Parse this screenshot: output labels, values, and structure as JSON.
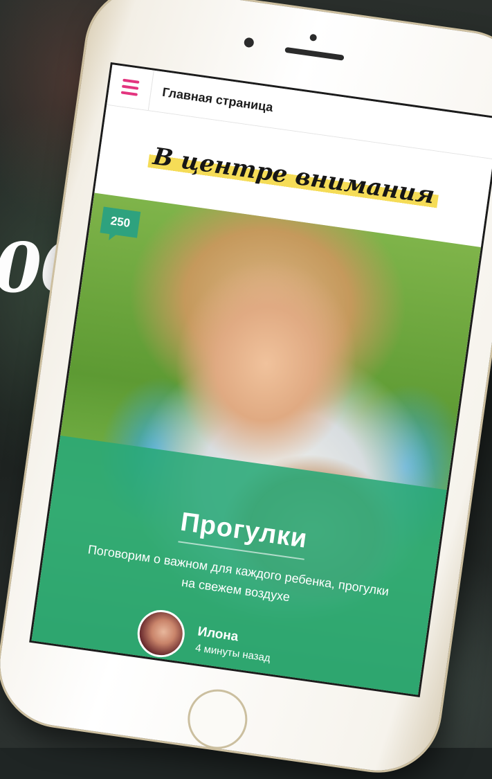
{
  "background_text": "00",
  "phone": {
    "topbar": {
      "page_title": "Главная страница"
    },
    "section_heading": "В центре внимания",
    "featured_post": {
      "comments_count": "250",
      "title": "Прогулки",
      "description": "Поговорим о важном для каждого ребенка, прогулки на свежем воздухе",
      "author": {
        "name": "Илона",
        "time_ago": "4 минуты назад"
      }
    }
  },
  "colors": {
    "accent_pink": "#e3357f",
    "accent_green": "#2ea27e",
    "highlight_yellow": "#f5dc57"
  },
  "icons": {
    "menu": "hamburger-icon"
  }
}
